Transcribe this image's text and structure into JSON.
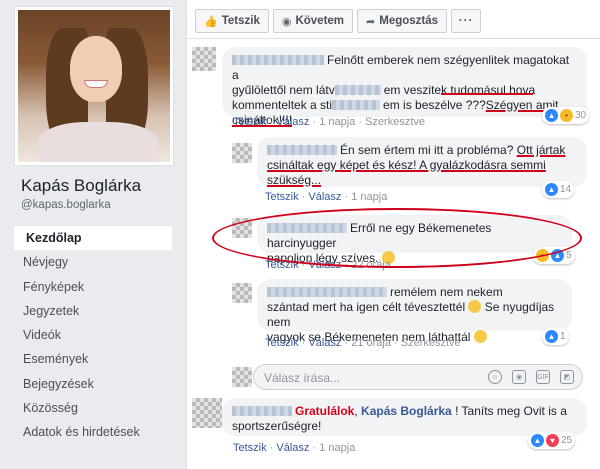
{
  "profile": {
    "name": "Kapás Boglárka",
    "handle": "@kapas.boglarka"
  },
  "nav": [
    {
      "label": "Kezdőlap",
      "active": true
    },
    {
      "label": "Névjegy"
    },
    {
      "label": "Fényképek"
    },
    {
      "label": "Jegyzetek"
    },
    {
      "label": "Videók"
    },
    {
      "label": "Események"
    },
    {
      "label": "Bejegyzések"
    },
    {
      "label": "Közösség"
    },
    {
      "label": "Adatok és hirdetések"
    }
  ],
  "actions": {
    "like": "Tetszik",
    "follow": "Követem",
    "share": "Megosztás",
    "more": "···"
  },
  "comments": [
    {
      "text_a": "Felnőtt emberek nem szégyenlitek magatokat a",
      "text_b": "gyűlölettől nem látv",
      "text_c": "em veszitek tudomásul hova",
      "text_d": "kommenteltek a sti",
      "text_e": "em is beszélve ???",
      "text_f": "Szégyen amit",
      "text_g": "csináltok!!!!",
      "like": "Tetszik",
      "reply": "Válasz",
      "time": "1 napja",
      "edited": "Szerkesztve",
      "reactions": "30"
    },
    {
      "text_a": "Én sem értem mi itt a probléma? ",
      "text_b": "Ott jártak",
      "text_c": "csináltak egy képet és kész! A gyalázkodásra semmi",
      "text_d": "szükség...",
      "like": "Tetszik",
      "reply": "Válasz",
      "time": "1 napja",
      "reactions": "14"
    },
    {
      "text_a": "Erről ne egy Békemenetes harcinyugger",
      "text_b": "papoljon légy szíves.",
      "like": "Tetszik",
      "reply": "Válasz",
      "time": "22 órája",
      "reactions": "5"
    },
    {
      "text_a": "remélem nem nekem",
      "text_b": "szántad mert ha igen célt tévesztettél",
      "text_c": "Se nyugdíjas nem",
      "text_d": "vagyok se Békemeneten nem láthattál",
      "like": "Tetszik",
      "reply": "Válasz",
      "time": "21 órája",
      "edited": "Szerkesztve",
      "reactions": "1"
    },
    {
      "prefix": "Gratulálok",
      "mention": "Kapás Boglárka",
      "text_a": "! Taníts meg Ovit is a",
      "text_b": "sportszerűségre!",
      "like": "Tetszik",
      "reply": "Válasz",
      "time": "1 napja",
      "reactions": "25"
    }
  ],
  "write": {
    "placeholder": "Válasz írása..."
  },
  "icons": {
    "gif": "GIF"
  }
}
